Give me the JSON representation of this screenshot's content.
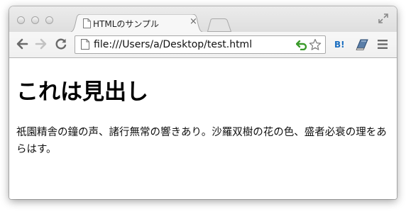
{
  "tab": {
    "title": "HTMLのサンプル",
    "close_glyph": "×"
  },
  "toolbar": {
    "url": "file:///Users/a/Desktop/test.html",
    "hatena_label": "B!"
  },
  "page": {
    "heading": "これは見出し",
    "paragraph": "祇園精舎の鐘の声、諸行無常の響きあり。沙羅双樹の花の色、盛者必衰の理をあらはす。"
  },
  "colors": {
    "hatena_blue": "#1a6ec0",
    "reload_green_arrow": "#3a9a2a"
  }
}
